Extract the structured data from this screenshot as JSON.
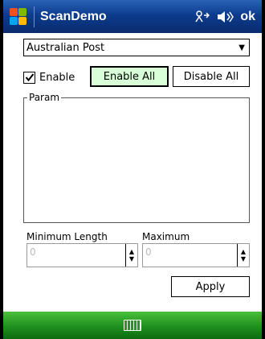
{
  "titlebar": {
    "app_title": "ScanDemo",
    "icons": [
      "windows-logo-icon",
      "connectivity-icon",
      "speaker-icon"
    ],
    "ok_label": "ok"
  },
  "symbology": {
    "selected": "Australian Post"
  },
  "enable": {
    "label": "Enable",
    "checked": true,
    "enable_all_label": "Enable All",
    "disable_all_label": "Disable All"
  },
  "param": {
    "legend": "Param"
  },
  "lengths": {
    "min_label": "Minimum Length",
    "max_label": "Maximum",
    "min_value": "0",
    "max_value": "0"
  },
  "apply_label": "Apply",
  "colors": {
    "titlebar": "#0d3c8e",
    "softkey_bar": "#1e8f1e",
    "focused_button": "#d8ffd8"
  }
}
